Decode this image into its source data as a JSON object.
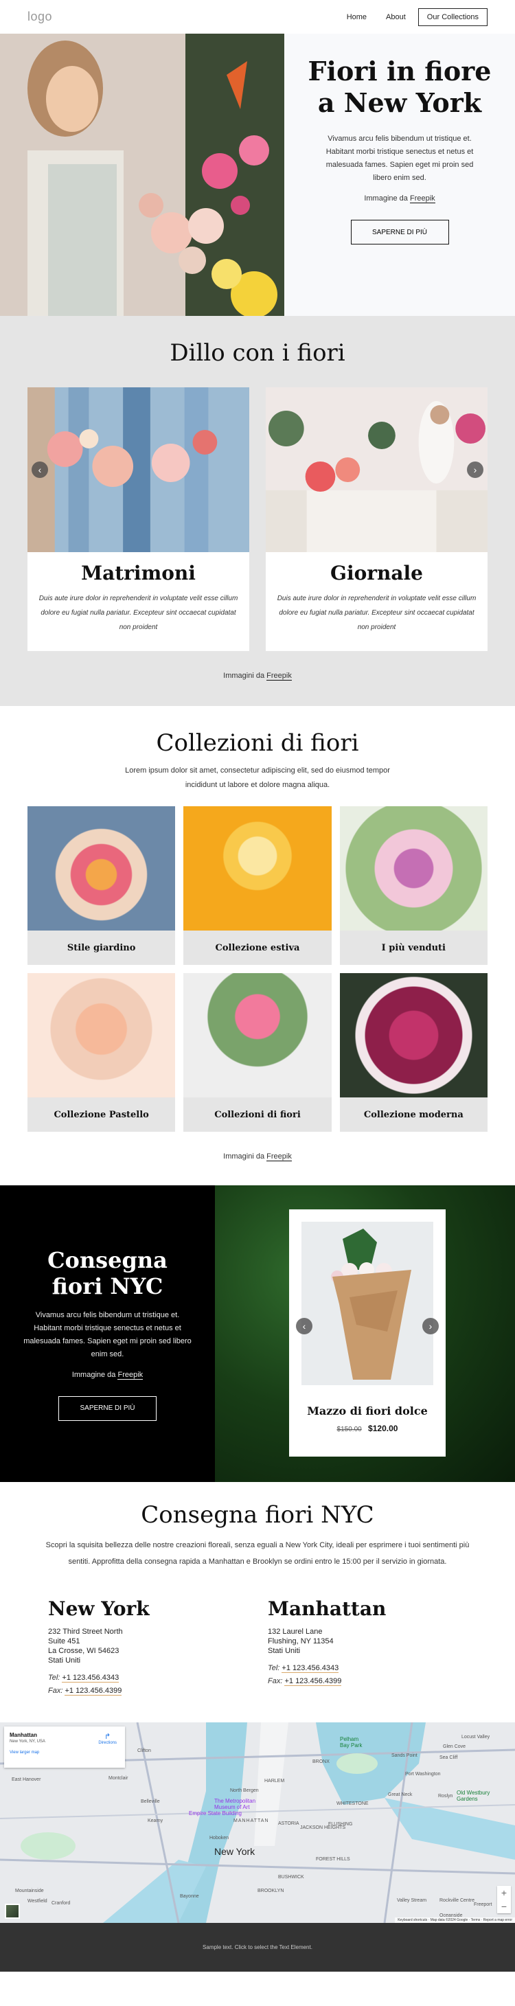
{
  "header": {
    "logo": "logo",
    "nav": [
      {
        "label": "Home"
      },
      {
        "label": "About"
      },
      {
        "label": "Our Collections"
      }
    ]
  },
  "hero": {
    "title": "Fiori in fiore a New York",
    "body": "Vivamus arcu felis bibendum ut tristique et. Habitant morbi tristique senectus et netus et malesuada fames. Sapien eget mi proin sed libero enim sed.",
    "credit_prefix": "Immagine da",
    "credit_link": "Freepik",
    "button": "SAPERNE DI PIÙ"
  },
  "dillo": {
    "title": "Dillo con i fiori",
    "cards": [
      {
        "title": "Matrimoni",
        "text": "Duis aute irure dolor in reprehenderit in voluptate velit esse cillum dolore eu fugiat nulla pariatur. Excepteur sint occaecat cupidatat non proident"
      },
      {
        "title": "Giornale",
        "text": "Duis aute irure dolor in reprehenderit in voluptate velit esse cillum dolore eu fugiat nulla pariatur. Excepteur sint occaecat cupidatat non proident"
      }
    ],
    "credit_prefix": "Immagini da",
    "credit_link": "Freepik",
    "prev_icon": "‹",
    "next_icon": "›"
  },
  "collections": {
    "title": "Collezioni di fiori",
    "subtitle": "Lorem ipsum dolor sit amet, consectetur adipiscing elit, sed do eiusmod tempor incididunt ut labore et dolore magna aliqua.",
    "items": [
      {
        "label": "Stile giardino"
      },
      {
        "label": "Collezione estiva"
      },
      {
        "label": "I più venduti"
      },
      {
        "label": "Collezione Pastello"
      },
      {
        "label": "Collezioni di fiori"
      },
      {
        "label": "Collezione moderna"
      }
    ],
    "credit_prefix": "Immagini da",
    "credit_link": "Freepik"
  },
  "delivery": {
    "title": "Consegna fiori NYC",
    "body": "Vivamus arcu felis bibendum ut tristique et. Habitant morbi tristique senectus et netus et malesuada fames. Sapien eget mi proin sed libero enim sed.",
    "credit_prefix": "Immagine da",
    "credit_link": "Freepik",
    "button": "SAPERNE DI PIÙ",
    "product": {
      "name": "Mazzo di fiori dolce",
      "old_price": "$150.00",
      "price": "$120.00"
    }
  },
  "contact": {
    "title": "Consegna fiori NYC",
    "subtitle": "Scopri la squisita bellezza delle nostre creazioni floreali, senza eguali a New York City, ideali per esprimere i tuoi sentimenti più sentiti. Approfitta della consegna rapida a Manhattan e Brooklyn se ordini entro le 15:00 per il servizio in giornata.",
    "offices": [
      {
        "title": "New York",
        "address": [
          "232 Third Street North",
          "Suite 451",
          "La Crosse, WI 54623",
          "Stati Uniti"
        ],
        "tel_label": "Tel:",
        "tel": "+1 123.456.4343",
        "fax_label": "Fax:",
        "fax": "+1 123.456.4399"
      },
      {
        "title": "Manhattan",
        "address": [
          "132 Laurel Lane",
          "Flushing, NY 11354",
          "Stati Uniti"
        ],
        "tel_label": "Tel:",
        "tel": "+1 123.456.4343",
        "fax_label": "Fax:",
        "fax": "+1 123.456.4399"
      }
    ]
  },
  "map": {
    "place": "Manhattan",
    "place_sub": "New York, NY, USA",
    "larger_map": "View larger map",
    "directions": "Directions",
    "big_label": "New York",
    "labels": [
      "North Bergen",
      "Belleville",
      "Kearny",
      "Hoboken",
      "Bayonne",
      "MANHATTAN",
      "ASTORIA",
      "JACKSON HEIGHTS",
      "BUSHWICK",
      "BROOKLYN",
      "FOREST HILLS",
      "HARLEM",
      "BRONX",
      "WHITESTONE",
      "FLUSHING",
      "Sands Point",
      "Port Washington",
      "Great Neck",
      "Roslyn",
      "Glen Cove",
      "Sea Cliff",
      "Locust Valley",
      "East Hanover",
      "Montclair",
      "Clifton",
      "Mountainside",
      "Westfield",
      "Cranford",
      "Valley Stream",
      "Rockville Centre",
      "Freeport",
      "Oceanside"
    ],
    "pois": [
      "The Metropolitan Museum of Art",
      "Empire State Building",
      "Pelham Bay Park",
      "Old Westbury Gardens"
    ],
    "zoom_in": "+",
    "zoom_out": "−",
    "footer": [
      "Keyboard shortcuts",
      "Map data ©2024 Google",
      "Terms",
      "Report a map error"
    ]
  },
  "footer": {
    "text": "Sample text. Click to select the Text Element."
  }
}
